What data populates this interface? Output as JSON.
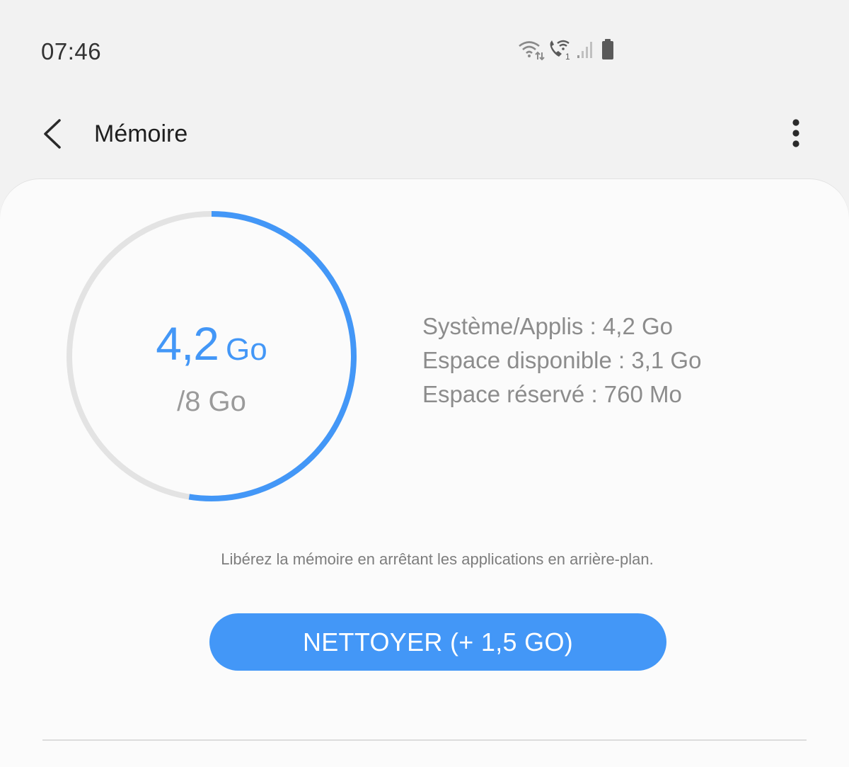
{
  "status_bar": {
    "time": "07:46",
    "icons": [
      "wifi-calling-icon",
      "wifi-call-icon",
      "signal-icon",
      "battery-icon"
    ]
  },
  "app_bar": {
    "title": "Mémoire",
    "back_icon": "chevron-left-icon",
    "menu_icon": "more-vertical-icon"
  },
  "memory": {
    "used_number": "4,2",
    "used_unit": "Go",
    "total": "/8 Go",
    "used_fraction": 0.525,
    "ring_color": "#4397f7",
    "track_color": "#e3e3e3"
  },
  "details": {
    "system_apps": "Système/Applis : 4,2 Go",
    "available": "Espace disponible : 3,1 Go",
    "reserved": "Espace réservé : 760 Mo"
  },
  "hint": "Libérez la mémoire en arrêtant les applications en arrière-plan.",
  "clean_button_label": "NETTOYER (+ 1,5 GO)",
  "colors": {
    "accent": "#4397f7",
    "background": "#f2f2f2",
    "card": "#fbfbfb"
  }
}
